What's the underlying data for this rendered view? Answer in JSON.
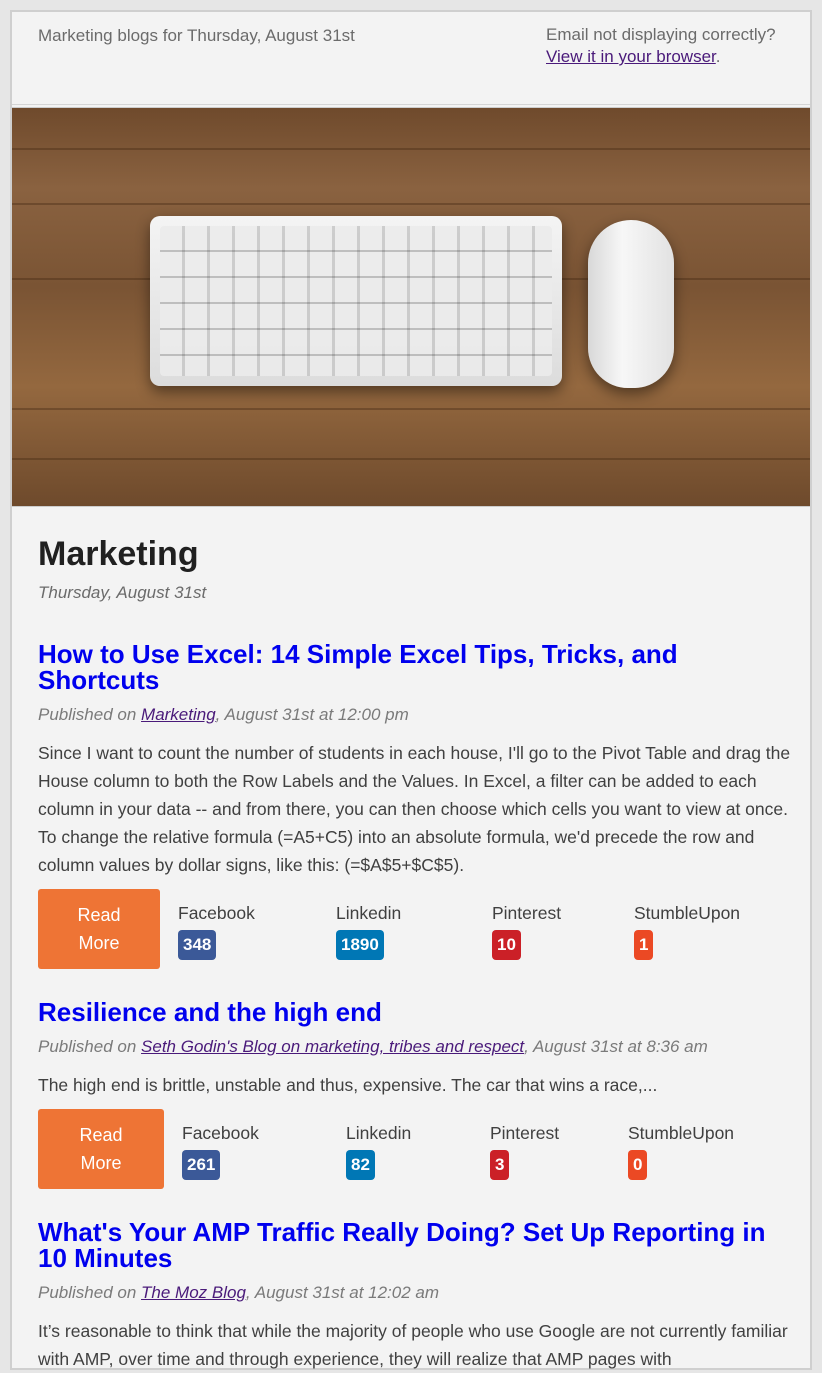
{
  "preheader": {
    "date_line": "Marketing blogs for Thursday, August 31st",
    "not_displaying": "Email not displaying correctly?",
    "view_link": "View it in your browser",
    "period": "."
  },
  "section": {
    "title": "Marketing",
    "date": "Thursday, August 31st"
  },
  "colors": {
    "facebook": "#3b5998",
    "linkedin": "#0077b5",
    "pinterest": "#cb2027",
    "stumbleupon": "#eb4924",
    "read_more": "#ee7435",
    "title_link": "#0000ee"
  },
  "posts": [
    {
      "title_line1": "How to Use Excel: 14 Simple Excel Tips, Tricks, and",
      "title_line2": "Shortcuts",
      "published_prefix": "Published on ",
      "source": "Marketing",
      "published_suffix": ", August 31st at 12:00 pm",
      "excerpt": "Since I want to count the number of students in each house, I'll go to the Pivot Table and drag the House column to both the Row Labels and the Values. In Excel, a filter can be added to each column in your data -- and from there, you can then choose which cells you want to view at once. To change the relative formula (=A5+C5) into an absolute formula, we'd precede the row and column values by dollar signs, like this: (=$A$5+$C$5).",
      "read_more_line1": "Read",
      "read_more_line2": "More",
      "facebook_label": "Facebook",
      "facebook_count": "348",
      "linkedin_label": "Linkedin",
      "linkedin_count": "1890",
      "pinterest_label": "Pinterest",
      "pinterest_count": "10",
      "stumbleupon_label": "StumbleUpon",
      "stumbleupon_count": "1"
    },
    {
      "title_line1": "Resilience and the high end",
      "published_prefix": "Published on ",
      "source": "Seth Godin's Blog on marketing, tribes and respect",
      "published_suffix": ", August 31st at 8:36 am",
      "excerpt": "The high end is brittle, unstable and thus, expensive. The car that wins a race,...",
      "read_more_line1": "Read",
      "read_more_line2": "More",
      "facebook_label": "Facebook",
      "facebook_count": "261",
      "linkedin_label": "Linkedin",
      "linkedin_count": "82",
      "pinterest_label": "Pinterest",
      "pinterest_count": "3",
      "stumbleupon_label": "StumbleUpon",
      "stumbleupon_count": "0"
    },
    {
      "title_line1": "What's Your AMP Traffic Really Doing? Set Up Reporting in",
      "title_line2": "10 Minutes",
      "published_prefix": "Published on ",
      "source": "The Moz Blog",
      "published_suffix": ", August 31st at 12:02 am",
      "excerpt": "It’s reasonable to think that while the majority of people who use Google are not currently familiar with AMP, over time and through experience, they will realize that AMP pages with"
    }
  ]
}
